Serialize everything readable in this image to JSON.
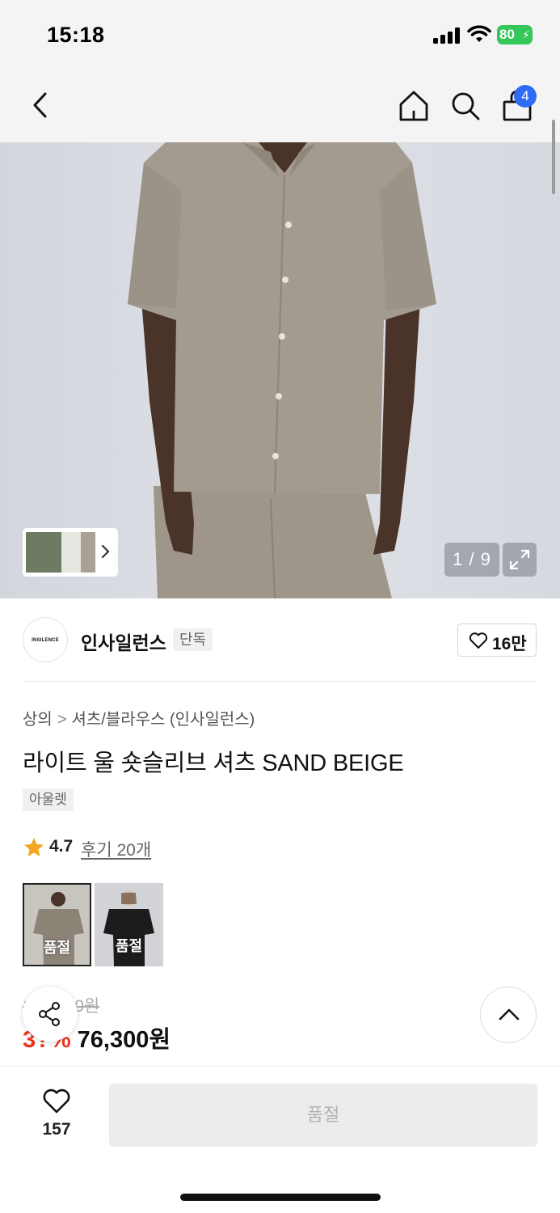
{
  "status_bar": {
    "time": "15:18",
    "battery": "80"
  },
  "nav": {
    "cart_count": "4",
    "icons": [
      "back-icon",
      "home-icon",
      "search-icon",
      "cart-icon"
    ]
  },
  "gallery": {
    "counter": "1 / 9"
  },
  "brand": {
    "logo_text": "INSILENCE",
    "name": "인사일런스",
    "tag": "단독",
    "likes": "16만"
  },
  "product": {
    "breadcrumb": [
      "상의",
      "셔츠/블라우스 (인사일런스)"
    ],
    "title": "라이트 울 숏슬리브 셔츠 SAND BEIGE",
    "outlet_tag": "아울렛",
    "rating": "4.7",
    "review_link": "후기 20개",
    "options": [
      {
        "label": "품절",
        "color": "SAND BEIGE"
      },
      {
        "label": "품절",
        "color": "BLACK"
      }
    ],
    "price_original": "1??,?00원",
    "discount": "3?%",
    "price_now": "76,300원"
  },
  "bottom_bar": {
    "wish_count": "157",
    "button_label": "품절"
  },
  "colors": {
    "accent_blue": "#2f6bf5",
    "discount_red": "#f0321e",
    "battery_green": "#34c759"
  }
}
